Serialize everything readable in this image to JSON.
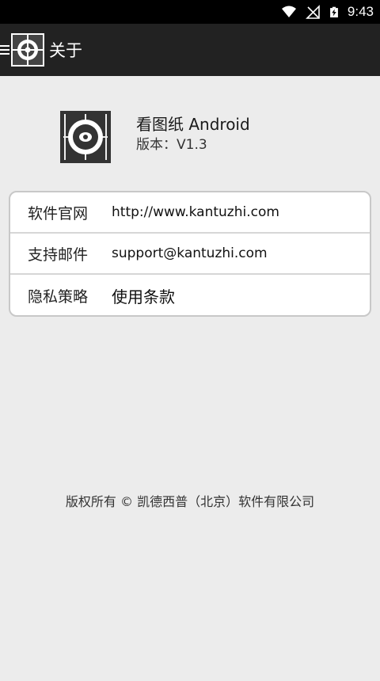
{
  "status_bar": {
    "time": "9:43",
    "icons": [
      "wifi-icon",
      "signal-off-icon",
      "battery-charging-icon"
    ]
  },
  "app_bar": {
    "title": "关于",
    "icons": [
      "menu-icon",
      "app-logo-icon"
    ]
  },
  "app_info": {
    "name": "看图纸 Android",
    "version": "版本：V1.3"
  },
  "info_rows": [
    {
      "label": "软件官网",
      "value": "http://www.kantuzhi.com"
    },
    {
      "label": "支持邮件",
      "value": "support@kantuzhi.com"
    },
    {
      "label": "隐私策略",
      "value": "使用条款"
    }
  ],
  "footer": {
    "copyright": "版权所有 © 凯德西普（北京）软件有限公司"
  }
}
